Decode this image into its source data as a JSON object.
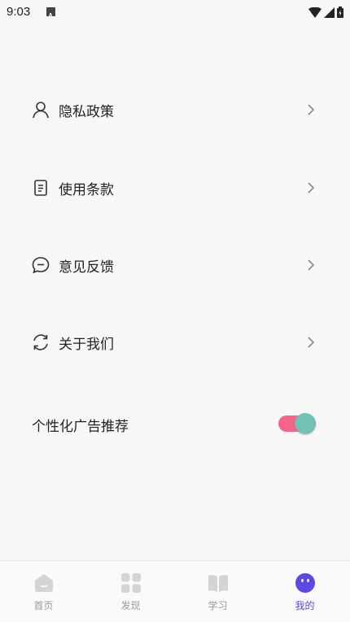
{
  "status_bar": {
    "time": "9:03"
  },
  "menu": {
    "items": [
      {
        "label": "隐私政策",
        "icon": "person-icon"
      },
      {
        "label": "使用条款",
        "icon": "document-icon"
      },
      {
        "label": "意见反馈",
        "icon": "chat-bubble-icon"
      },
      {
        "label": "关于我们",
        "icon": "refresh-icon"
      }
    ]
  },
  "personalized_ads": {
    "label": "个性化广告推荐",
    "enabled": true
  },
  "tabbar": {
    "tabs": [
      {
        "label": "首页",
        "icon": "home-icon",
        "active": false
      },
      {
        "label": "发现",
        "icon": "grid-icon",
        "active": false
      },
      {
        "label": "学习",
        "icon": "book-icon",
        "active": false
      },
      {
        "label": "我的",
        "icon": "profile-face-icon",
        "active": true
      }
    ]
  },
  "colors": {
    "toggle_track": "#f66488",
    "toggle_knob": "#73c0b4",
    "active_tab": "#5b49e6",
    "inactive_tab": "#9a9a9a"
  }
}
